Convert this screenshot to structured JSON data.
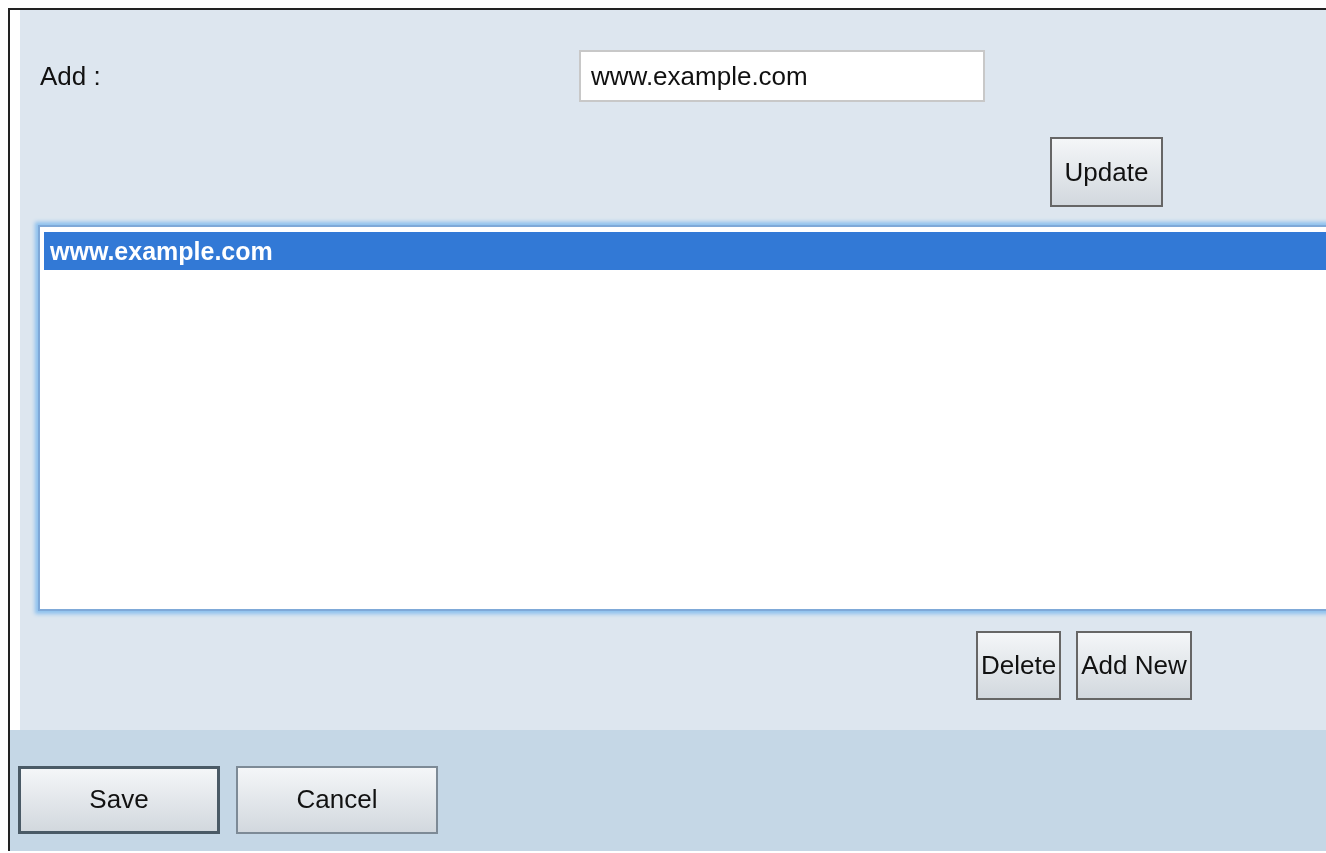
{
  "add_label": "Add :",
  "add_field": {
    "value": "www.example.com"
  },
  "update_button": "Update",
  "list": {
    "items": [
      {
        "label": "www.example.com",
        "selected": true
      }
    ]
  },
  "list_buttons": [
    "Delete",
    "Add New"
  ],
  "footer_buttons": [
    {
      "label": "Save",
      "focused": true
    },
    {
      "label": "Cancel",
      "focused": false
    }
  ]
}
